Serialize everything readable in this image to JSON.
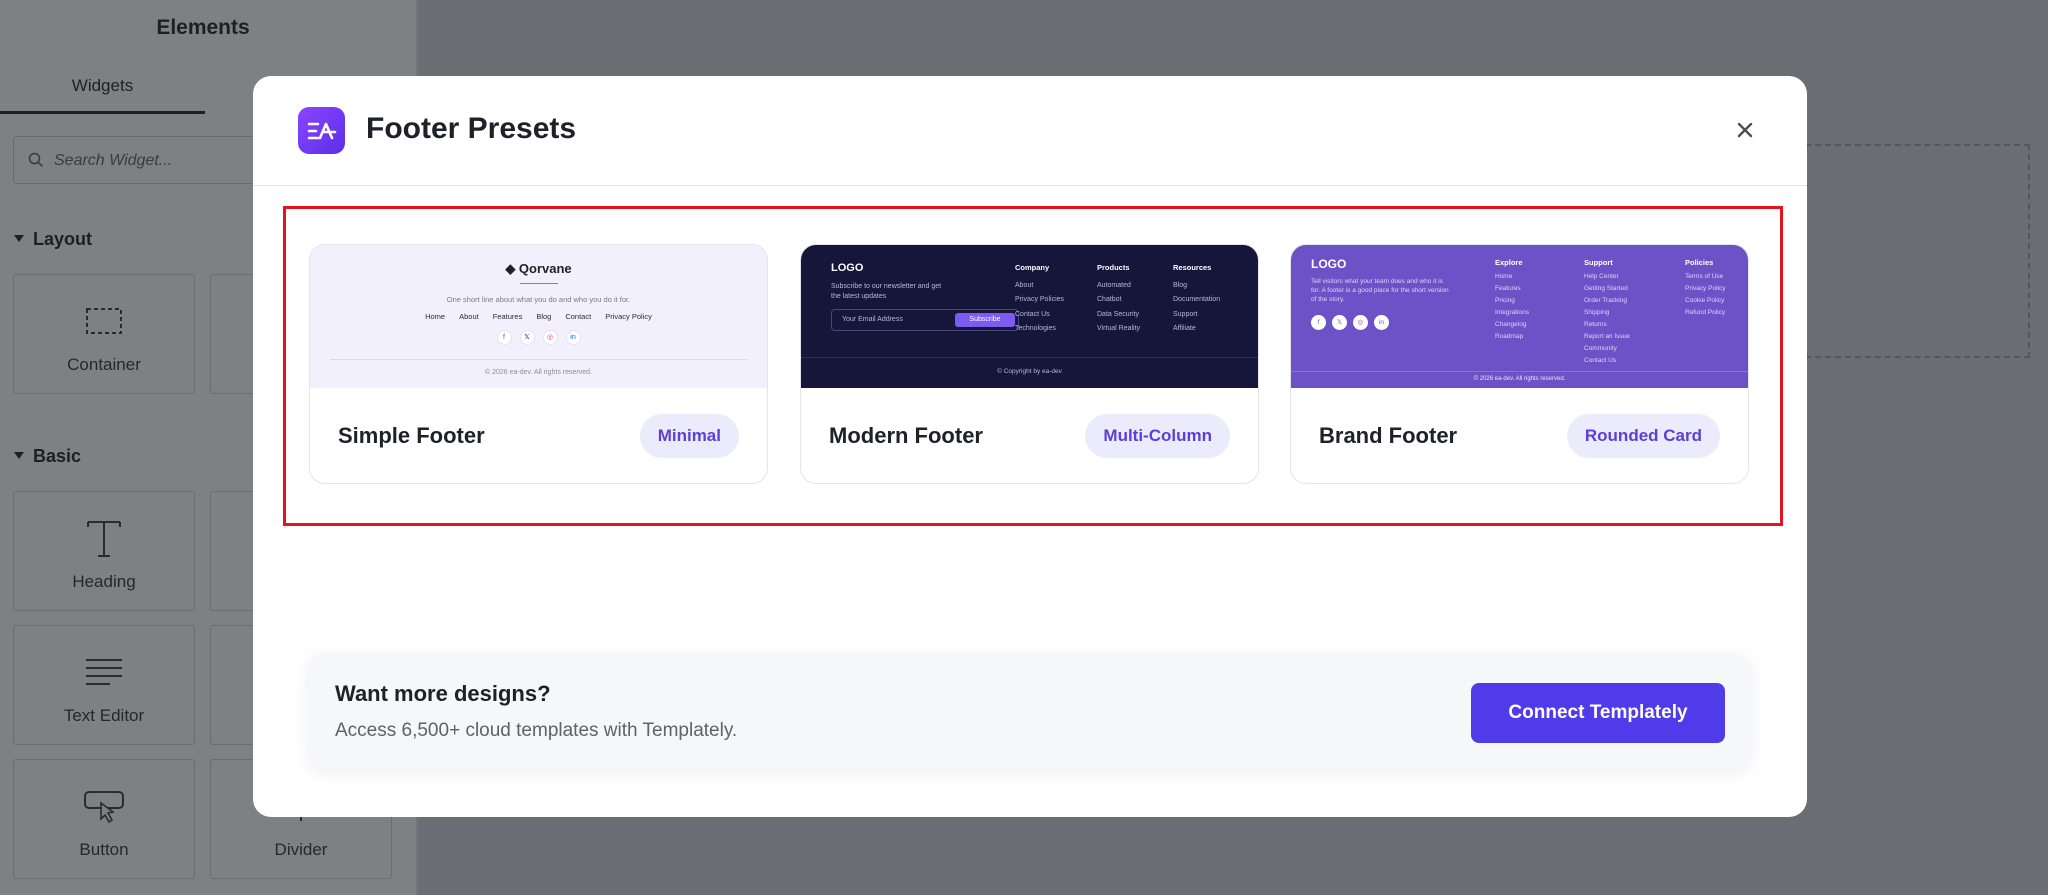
{
  "editor": {
    "panel_title": "Elements",
    "tabs": [
      {
        "label": "Widgets"
      }
    ],
    "search_placeholder": "Search Widget...",
    "sections": [
      {
        "label": "Layout",
        "widgets": [
          {
            "label": "Container",
            "icon": "container-icon"
          }
        ]
      },
      {
        "label": "Basic",
        "widgets": [
          {
            "label": "Heading",
            "icon": "heading-icon"
          },
          {
            "label": "Text Editor",
            "icon": "text-editor-icon"
          },
          {
            "label": "Button",
            "icon": "button-icon"
          },
          {
            "label": "Divider",
            "icon": "divider-icon"
          }
        ]
      }
    ]
  },
  "modal": {
    "title": "Footer Presets",
    "brand_color": "#7c3aed",
    "highlight_color": "#e3141c",
    "presets": [
      {
        "name": "Simple Footer",
        "tag": "Minimal",
        "preview": {
          "brand": "Qorvane",
          "tagline": "One short line about what you do and who you do it for.",
          "nav": [
            "Home",
            "About",
            "Features",
            "Blog",
            "Contact",
            "Privacy Policy"
          ],
          "socials": [
            "f",
            "𝕏",
            "◎",
            "in"
          ],
          "copyright": "© 2026 ea-dev. All rights reserved."
        }
      },
      {
        "name": "Modern Footer",
        "tag": "Multi-Column",
        "preview": {
          "logo": "LOGO",
          "subscribe_text": "Subscribe to our newsletter and get the latest updates",
          "email_placeholder": "Your Email Address",
          "subscribe_button": "Subscribe",
          "columns": [
            {
              "title": "Company",
              "links": [
                "About",
                "Privacy Policies",
                "Contact Us",
                "Technologies"
              ]
            },
            {
              "title": "Products",
              "links": [
                "Automated",
                "Chatbot",
                "Data Security",
                "Virtual Reality"
              ]
            },
            {
              "title": "Resources",
              "links": [
                "Blog",
                "Documentation",
                "Support",
                "Affiliate"
              ]
            }
          ],
          "copyright": "© Copyright by ea-dev"
        }
      },
      {
        "name": "Brand Footer",
        "tag": "Rounded Card",
        "preview": {
          "logo": "LOGO",
          "description": "Tell visitors what your team does and who it is for. A footer is a good place for the short version of the story.",
          "socials": [
            "f",
            "𝕏",
            "◎",
            "in"
          ],
          "columns": [
            {
              "title": "Explore",
              "links": [
                "Home",
                "Features",
                "Pricing",
                "Integrations",
                "Changelog",
                "Roadmap"
              ]
            },
            {
              "title": "Support",
              "links": [
                "Help Center",
                "Getting Started",
                "Order Tracking",
                "Shipping",
                "Returns",
                "Report an Issue",
                "Community",
                "Contact Us"
              ]
            },
            {
              "title": "Policies",
              "links": [
                "Terms of Use",
                "Privacy Policy",
                "Cookie Policy",
                "Refund Policy"
              ]
            }
          ],
          "copyright": "© 2026 ea-dev. All rights reserved."
        }
      }
    ],
    "promo": {
      "title": "Want more designs?",
      "subtitle": "Access 6,500+ cloud templates with Templately.",
      "button": "Connect Templately"
    }
  }
}
